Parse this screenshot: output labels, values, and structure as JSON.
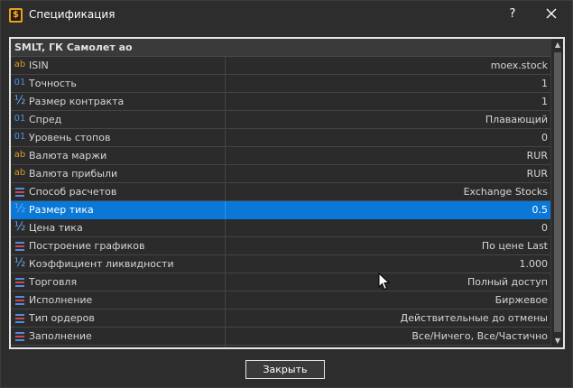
{
  "window": {
    "title": "Спецификация",
    "help_label": "?",
    "app_icon_glyph": "$"
  },
  "table": {
    "header": "SMLT, ГК Самолет ао",
    "rows": [
      {
        "icon": "ab",
        "name": "ISIN",
        "value": "moex.stock"
      },
      {
        "icon": "01",
        "name": "Точность",
        "value": "1"
      },
      {
        "icon": "½",
        "name": "Размер контракта",
        "value": "1"
      },
      {
        "icon": "01",
        "name": "Спред",
        "value": "Плавающий"
      },
      {
        "icon": "01",
        "name": "Уровень стопов",
        "value": "0"
      },
      {
        "icon": "ab",
        "name": "Валюта маржи",
        "value": "RUR"
      },
      {
        "icon": "ab",
        "name": "Валюта прибыли",
        "value": "RUR"
      },
      {
        "icon": "enum",
        "name": "Способ расчетов",
        "value": "Exchange Stocks"
      },
      {
        "icon": "½",
        "name": "Размер тика",
        "value": "0.5",
        "selected": true
      },
      {
        "icon": "½",
        "name": "Цена тика",
        "value": "0"
      },
      {
        "icon": "enum",
        "name": "Построение графиков",
        "value": "По цене Last"
      },
      {
        "icon": "½",
        "name": "Коэффициент ликвидности",
        "value": "1.000"
      },
      {
        "icon": "enum",
        "name": "Торговля",
        "value": "Полный доступ"
      },
      {
        "icon": "enum",
        "name": "Исполнение",
        "value": "Биржевое"
      },
      {
        "icon": "enum",
        "name": "Тип ордеров",
        "value": "Действительные до отмены"
      },
      {
        "icon": "enum",
        "name": "Заполнение",
        "value": "Все/Ничего, Все/Частично"
      },
      {
        "icon": "enum",
        "name": "",
        "value": ""
      }
    ]
  },
  "buttons": {
    "close_label": "Закрыть"
  },
  "colors": {
    "selection": "#0a78d7",
    "icon_text": "#d89a2a",
    "icon_int": "#4c8fe0"
  }
}
